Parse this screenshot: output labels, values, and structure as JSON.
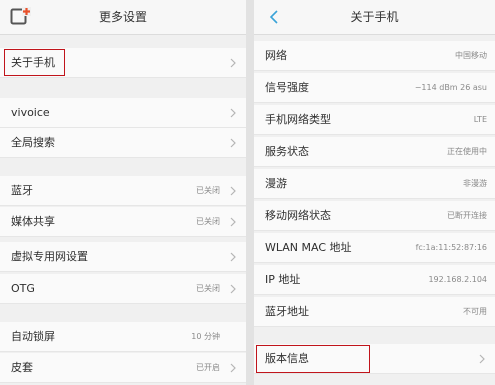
{
  "left": {
    "title": "更多设置",
    "items": [
      {
        "label": "关于手机",
        "value": ""
      },
      {
        "label": "vivoice",
        "value": ""
      },
      {
        "label": "全局搜索",
        "value": ""
      },
      {
        "label": "蓝牙",
        "value": "已关闭"
      },
      {
        "label": "媒体共享",
        "value": "已关闭"
      },
      {
        "label": "虚拟专用网设置",
        "value": ""
      },
      {
        "label": "OTG",
        "value": "已关闭"
      },
      {
        "label": "自动锁屏",
        "value": "10 分钟"
      },
      {
        "label": "皮套",
        "value": "已开启"
      }
    ]
  },
  "right": {
    "title": "关于手机",
    "items": [
      {
        "label": "网络",
        "value": "中国移动"
      },
      {
        "label": "信号强度",
        "value": "−114 dBm  26 asu"
      },
      {
        "label": "手机网络类型",
        "value": "LTE"
      },
      {
        "label": "服务状态",
        "value": "正在使用中"
      },
      {
        "label": "漫游",
        "value": "非漫游"
      },
      {
        "label": "移动网络状态",
        "value": "已断开连接"
      },
      {
        "label": "WLAN MAC 地址",
        "value": "fc:1a:11:52:87:16"
      },
      {
        "label": "IP 地址",
        "value": "192.168.2.104"
      },
      {
        "label": "蓝牙地址",
        "value": "不可用"
      },
      {
        "label": "版本信息",
        "value": ""
      }
    ]
  },
  "colors": {
    "highlight": "#c0141b",
    "app_icon_accent": "#e8512a",
    "back_arrow": "#3aa3d8"
  },
  "icons": {
    "app": "settings-app-icon",
    "back": "back-arrow-icon",
    "chevron": "chevron-right-icon"
  }
}
